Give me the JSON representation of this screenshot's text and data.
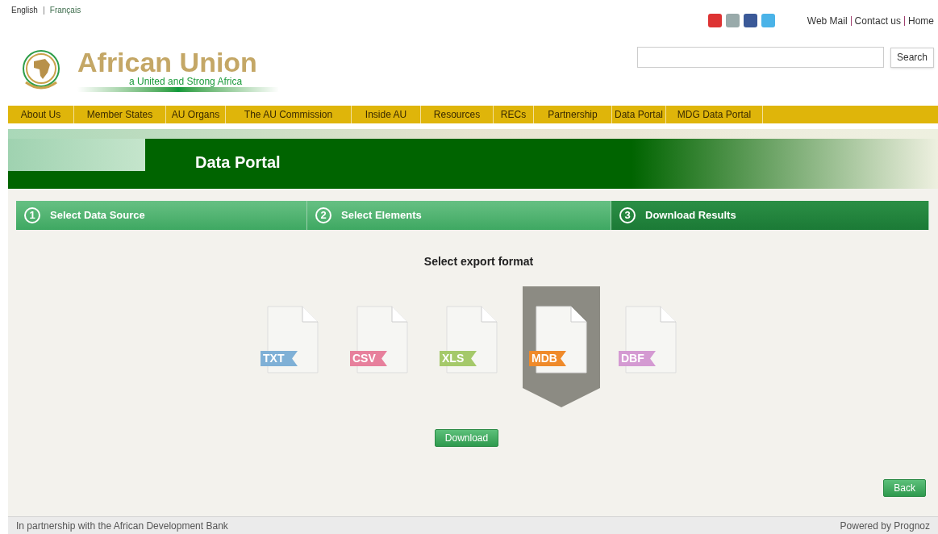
{
  "languages": [
    {
      "label": "English",
      "selected": true
    },
    {
      "label": "Français",
      "selected": false
    }
  ],
  "top_links": [
    "Web Mail",
    "Contact us",
    "Home"
  ],
  "logo": {
    "title": "African Union",
    "tagline": "a United and Strong Africa"
  },
  "search": {
    "button": "Search"
  },
  "nav": [
    "About Us",
    "Member States",
    "AU Organs",
    "The AU Commission",
    "Inside AU",
    "Resources",
    "RECs",
    "Partnership",
    "Data Portal",
    "MDG Data Portal"
  ],
  "banner": {
    "title": "Data Portal"
  },
  "steps": [
    {
      "number": "1",
      "label": "Select Data Source",
      "selected": false
    },
    {
      "number": "2",
      "label": "Select Elements",
      "selected": false
    },
    {
      "number": "3",
      "label": "Download Results",
      "selected": true
    }
  ],
  "export": {
    "heading": "Select export format",
    "formats": [
      {
        "label": "TXT",
        "color": "#7fb0d6",
        "selected": false
      },
      {
        "label": "CSV",
        "color": "#e7809c",
        "selected": false
      },
      {
        "label": "XLS",
        "color": "#a5c96a",
        "selected": false
      },
      {
        "label": "MDB",
        "color": "#ef8a2a",
        "selected": true
      },
      {
        "label": "DBF",
        "color": "#d49ad2",
        "selected": false
      }
    ],
    "download": "Download"
  },
  "back": "Back",
  "footer": {
    "left": "In partnership with the African Development Bank",
    "right": "Powered by Prognoz"
  }
}
